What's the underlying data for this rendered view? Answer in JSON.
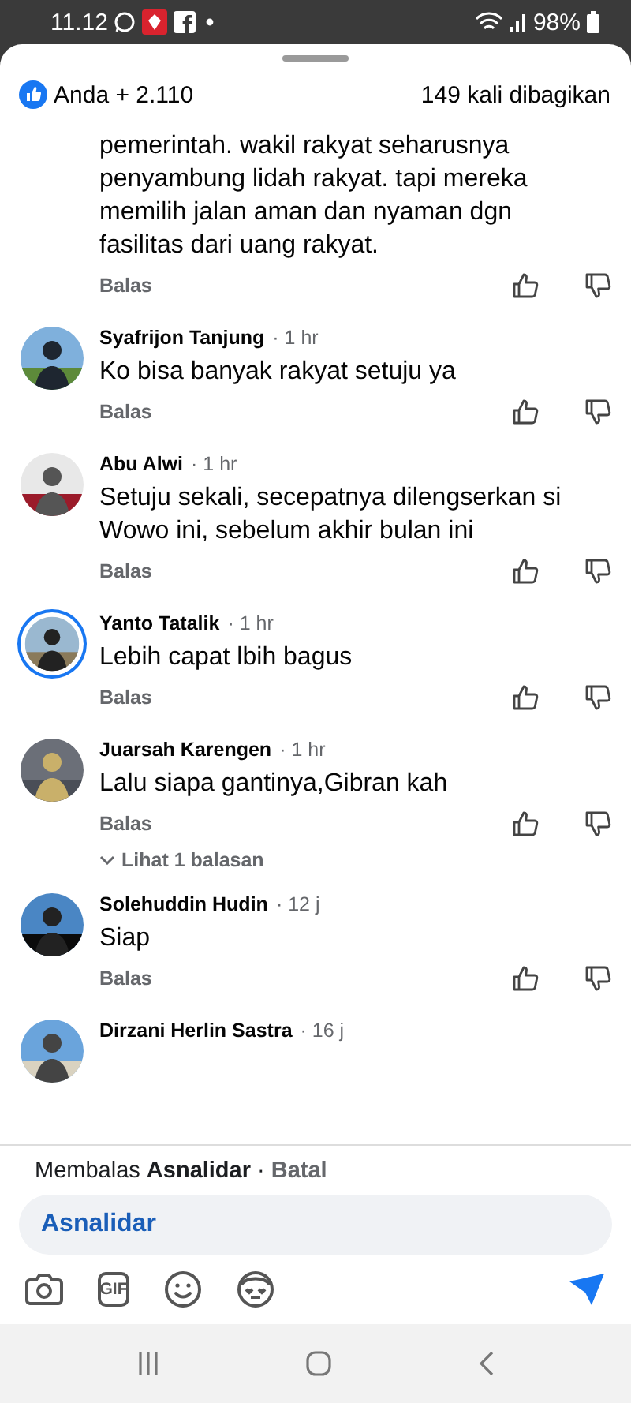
{
  "status_bar": {
    "time": "11.12",
    "battery": "98%"
  },
  "header": {
    "reactions": "Anda + 2.110",
    "shares": "149 kali dibagikan"
  },
  "comments": [
    {
      "body": "pemerintah. wakil rakyat seharusnya penyambung lidah rakyat. tapi mereka memilih jalan aman dan nyaman dgn fasilitas dari uang rakyat.",
      "reply": "Balas"
    },
    {
      "name": "Syafrijon Tanjung",
      "time": "· 1 hr",
      "body": "Ko bisa banyak rakyat setuju ya",
      "reply": "Balas",
      "story_ring": false
    },
    {
      "name": "Abu Alwi",
      "time": "· 1 hr",
      "body": "Setuju sekali, secepatnya dilengserkan si Wowo ini, sebelum akhir bulan ini",
      "reply": "Balas",
      "story_ring": false
    },
    {
      "name": "Yanto Tatalik",
      "time": "· 1 hr",
      "body": "Lebih capat lbih bagus",
      "reply": "Balas",
      "story_ring": true
    },
    {
      "name": "Juarsah Karengen",
      "time": "· 1 hr",
      "body": "Lalu siapa gantinya,Gibran kah",
      "reply": "Balas",
      "story_ring": false,
      "replies_link": "Lihat 1 balasan"
    },
    {
      "name": "Solehuddin Hudin",
      "time": "· 12 j",
      "body": "Siap",
      "reply": "Balas",
      "story_ring": false
    },
    {
      "name": "Dirzani Herlin Sastra",
      "time": "· 16 j",
      "story_ring": false
    }
  ],
  "reply_bar": {
    "status": "Membalas **Asnalidar** ·",
    "cancel": "Batal",
    "input_value": "Asnalidar",
    "gif_label": "GIF"
  }
}
